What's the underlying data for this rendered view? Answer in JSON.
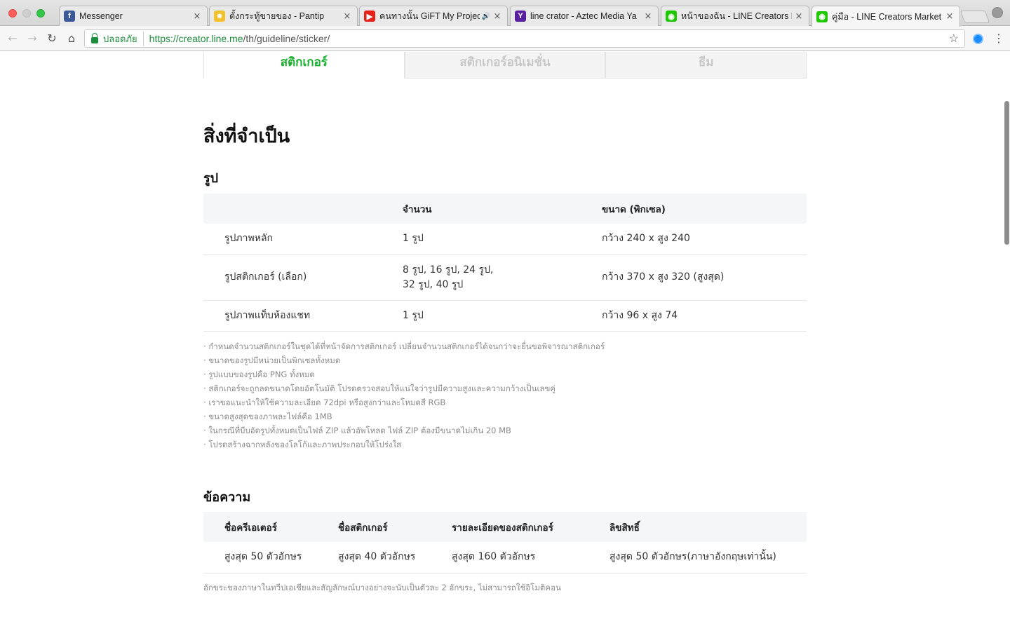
{
  "browser": {
    "tabs": [
      {
        "title": "Messenger",
        "icon": "facebook-icon",
        "color": "#3b5998",
        "glyph": "f"
      },
      {
        "title": "ตั้งกระทู้ขายของ - Pantip",
        "icon": "pantip-icon",
        "color": "#f2c12e",
        "glyph": "☻"
      },
      {
        "title": "คนทางนั้น GiFT My Project",
        "icon": "youtube-icon",
        "color": "#e62117",
        "glyph": "▶",
        "speaker": "🔊"
      },
      {
        "title": "line crator - Aztec Media Ya",
        "icon": "yahoo-icon",
        "color": "#5a1ea0",
        "glyph": "Y"
      },
      {
        "title": "หน้าของฉัน - LINE Creators M",
        "icon": "line-icon",
        "color": "#1dc800",
        "glyph": "◉"
      },
      {
        "title": "คู่มือ - LINE Creators Market",
        "icon": "line-icon",
        "color": "#1dc800",
        "glyph": "◉",
        "active": true
      }
    ],
    "secure_label": "ปลอดภัย",
    "url_host": "https://creator.line.me",
    "url_path": "/th/guideline/sticker/"
  },
  "type_tabs": [
    {
      "label": "สติกเกอร์",
      "active": true
    },
    {
      "label": "สติกเกอร์อนิเมชั่น",
      "active": false
    },
    {
      "label": "ธีม",
      "active": false
    }
  ],
  "section_title": "สิ่งที่จำเป็น",
  "images": {
    "heading": "รูป",
    "columns": [
      "",
      "จำนวน",
      "ขนาด (พิกเซล)"
    ],
    "rows": [
      {
        "name": "รูปภาพหลัก",
        "count": "1 รูป",
        "size": "กว้าง 240 x สูง 240"
      },
      {
        "name": "รูปสติกเกอร์ (เลือก)",
        "count": "8 รูป, 16 รูป, 24 รูป,\n32 รูป, 40 รูป",
        "size": "กว้าง 370 x สูง 320 (สูงสุด)"
      },
      {
        "name": "รูปภาพแท็บห้องแชท",
        "count": "1 รูป",
        "size": "กว้าง 96 x สูง 74"
      }
    ],
    "notes": [
      "กำหนดจำนวนสติกเกอร์ในชุดได้ที่หน้าจัดการสติกเกอร์ เปลี่ยนจำนวนสติกเกอร์ได้จนกว่าจะยื่นขอพิจารณาสติกเกอร์",
      "ขนาดของรูปมีหน่วยเป็นพิกเซลทั้งหมด",
      "รูปแบบของรูปคือ PNG ทั้งหมด",
      "สติกเกอร์จะถูกลดขนาดโดยอัตโนมัติ โปรดตรวจสอบให้แน่ใจว่ารูปมีความสูงและความกว้างเป็นเลขคู่",
      "เราขอแนะนำให้ใช้ความละเอียด 72dpi หรือสูงกว่าและโหมดสี RGB",
      "ขนาดสูงสุดของภาพละไฟล์คือ 1MB",
      "ในกรณีที่บีบอัดรูปทั้งหมดเป็นไฟล์ ZIP แล้วอัพโหลด ไฟล์ ZIP ต้องมีขนาดไม่เกิน 20 MB",
      "โปรดสร้างฉากหลังของโลโก้และภาพประกอบให้โปร่งใส"
    ]
  },
  "text": {
    "heading": "ข้อความ",
    "columns": [
      "ชื่อครีเอเตอร์",
      "ชื่อสติกเกอร์",
      "รายละเอียดของสติกเกอร์",
      "ลิขสิทธิ์"
    ],
    "row": [
      "สูงสุด 50 ตัวอักษร",
      "สูงสุด 40 ตัวอักษร",
      "สูงสุด 160 ตัวอักษร",
      "สูงสุด 50 ตัวอักษร(ภาษาอังกฤษเท่านั้น)"
    ],
    "footnote": "อักขระของภาษาในทวีปเอเชียและสัญลักษณ์บางอย่างจะนับเป็นตัวละ 2 อักขระ, ไม่สามารถใช้อิโมติคอน"
  }
}
